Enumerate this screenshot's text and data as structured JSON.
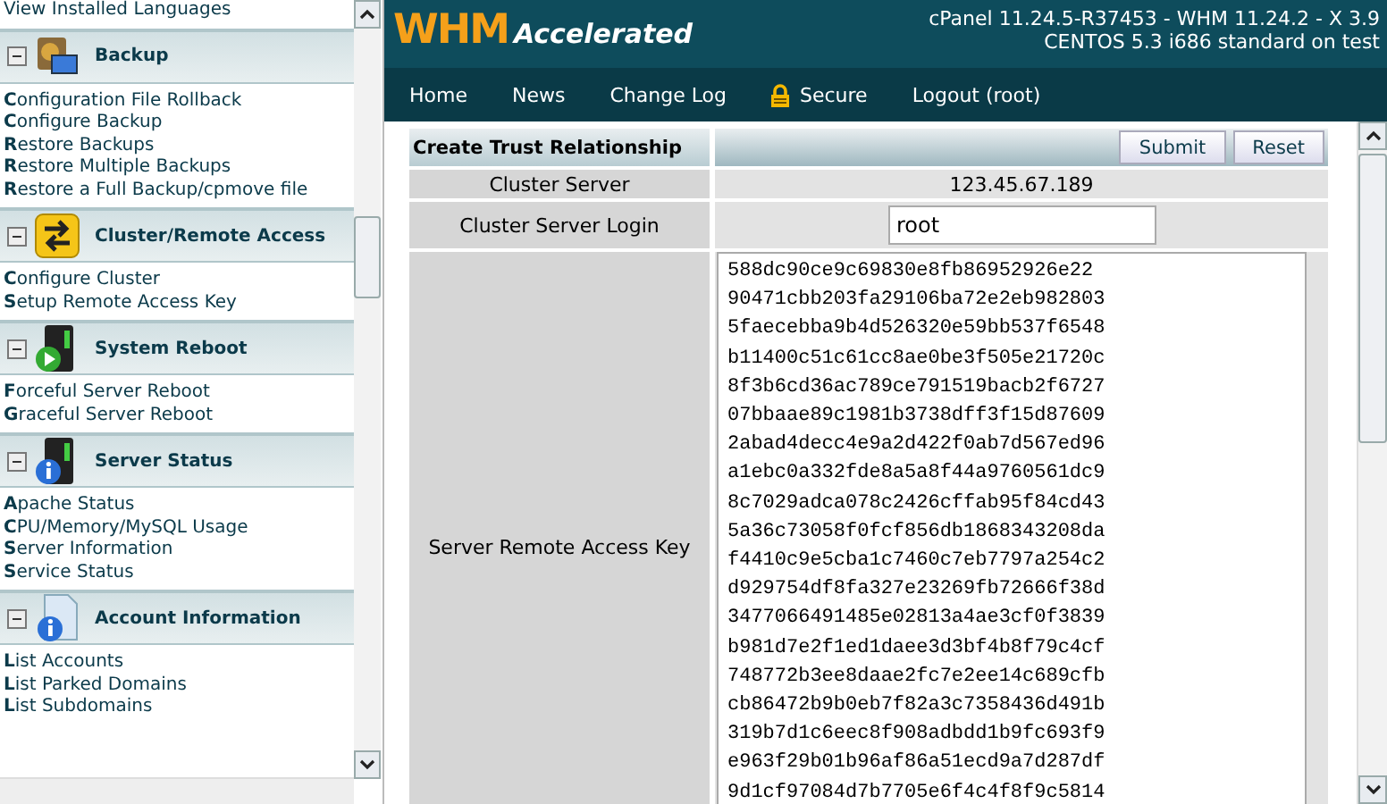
{
  "sidebar": {
    "top_item": "View Installed Languages",
    "groups": [
      {
        "title": "Backup",
        "expanded": true,
        "items": [
          "**C**onfiguration File Rollback",
          "**C**onfigure Backup",
          "**R**estore Backups",
          "**R**estore Multiple Backups",
          "**R**estore a Full Backup/cpmove file"
        ]
      },
      {
        "title": "Cluster/Remote Access",
        "expanded": true,
        "items": [
          "**C**onfigure Cluster",
          "**S**etup Remote Access Key"
        ]
      },
      {
        "title": "System Reboot",
        "expanded": true,
        "items": [
          "**F**orceful Server Reboot",
          "**G**raceful Server Reboot"
        ]
      },
      {
        "title": "Server Status",
        "expanded": true,
        "items": [
          "**A**pache Status",
          "**C**PU/Memory/MySQL Usage",
          "**S**erver Information",
          "**S**ervice Status"
        ]
      },
      {
        "title": "Account Information",
        "expanded": true,
        "items": [
          "**L**ist Accounts",
          "**L**ist Parked Domains",
          "**L**ist Subdomains"
        ]
      }
    ]
  },
  "header": {
    "logo_main": "WHM",
    "logo_sub": "Accelerated",
    "version_lines": [
      "cPanel 11.24.5-R37453 - WHM 11.24.2 - X 3.9",
      "CENTOS 5.3 i686 standard on test"
    ]
  },
  "nav": [
    {
      "label": "Home",
      "kind": "plain"
    },
    {
      "label": "News",
      "kind": "plain"
    },
    {
      "label": "Change Log",
      "kind": "plain"
    },
    {
      "label": "Secure",
      "kind": "secure"
    },
    {
      "label": "Logout (root)",
      "kind": "plain"
    }
  ],
  "form": {
    "title": "Create Trust Relationship",
    "buttons": [
      "Submit",
      "Reset"
    ],
    "rows": [
      {
        "kind": "text",
        "label": "Cluster Server",
        "value": "123.45.67.189"
      },
      {
        "kind": "input",
        "label": "Cluster Server Login",
        "value": "root"
      },
      {
        "kind": "textarea",
        "label": "Server Remote Access Key",
        "lines": [
          "588dc90ce9c69830e8fb86952926e22",
          "90471cbb203fa29106ba72e2eb982803",
          "5faecebba9b4d526320e59bb537f6548",
          "b11400c51c61cc8ae0be3f505e21720c",
          "8f3b6cd36ac789ce791519bacb2f6727",
          "07bbaae89c1981b3738dff3f15d87609",
          "2abad4decc4e9a2d422f0ab7d567ed96",
          "a1ebc0a332fde8a5a8f44a9760561dc9",
          "8c7029adca078c2426cffab95f84cd43",
          "5a36c73058f0fcf856db1868343208da",
          "f4410c9e5cba1c7460c7eb7797a254c2",
          "d929754df8fa327e23269fb72666f38d",
          "3477066491485e02813a4ae3cf0f3839",
          "b981d7e2f1ed1daee3d3bf4b8f79c4cf",
          "748772b3ee8daae2fc7e2ee14c689cfb",
          "cb86472b9b0eb7f82a3c7358436d491b",
          "319b7d1c6eec8f908adbdd1b9fc693f9",
          "e963f29b01b96af86a51ecd9a7d287df",
          "9d1cf97084d7b7705e6f4c4f8f9c5814"
        ]
      }
    ]
  }
}
